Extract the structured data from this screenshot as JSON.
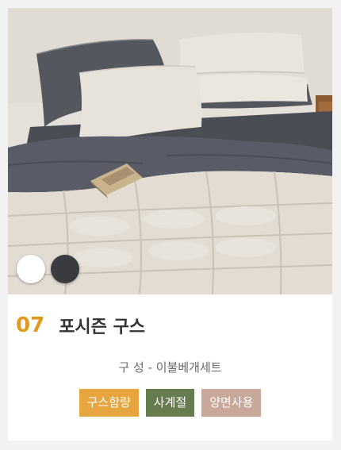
{
  "product": {
    "number": "07",
    "name": "포시즌 구스",
    "spec": "구 성 - 이불베개세트",
    "color_swatches": [
      {
        "name": "white",
        "color": "#ffffff"
      },
      {
        "name": "charcoal",
        "color": "#3a3b40"
      }
    ],
    "tags": [
      {
        "label": "구스함량",
        "color": "#e6a53e"
      },
      {
        "label": "사계절",
        "color": "#667b4e"
      },
      {
        "label": "양면사용",
        "color": "#c8a89a"
      }
    ]
  }
}
